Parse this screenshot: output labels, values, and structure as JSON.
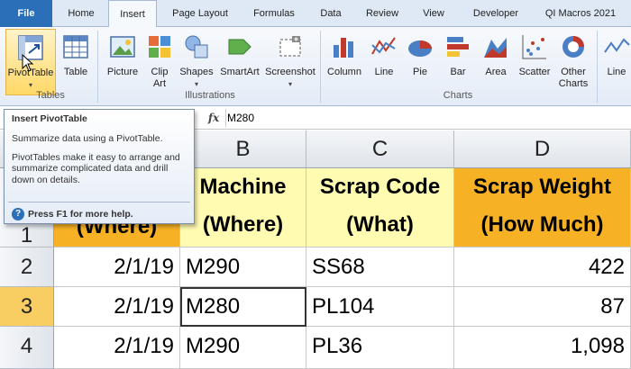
{
  "tabs": [
    "File",
    "Home",
    "Insert",
    "Page Layout",
    "Formulas",
    "Data",
    "Review",
    "View",
    "Developer",
    "QI Macros 2021"
  ],
  "ribbon": {
    "buttons": {
      "pivottable": "PivotTable",
      "table": "Table",
      "picture": "Picture",
      "clipart": "Clip Art",
      "shapes": "Shapes",
      "smartart": "SmartArt",
      "screenshot": "Screenshot",
      "column": "Column",
      "line": "Line",
      "pie": "Pie",
      "bar": "Bar",
      "area": "Area",
      "scatter": "Scatter",
      "othercharts": "Other Charts",
      "sparkline": "Line"
    },
    "groups": {
      "tables": "Tables",
      "illustrations": "Illustrations",
      "charts": "Charts"
    }
  },
  "formula_bar": {
    "fx": "fx",
    "value": "M280"
  },
  "tooltip": {
    "title": "Insert PivotTable",
    "line1": "Summarize data using a PivotTable.",
    "line2": "PivotTables make it easy to arrange and summarize complicated data and drill down on details.",
    "help": "Press F1 for more help."
  },
  "grid": {
    "columns": [
      "B",
      "C",
      "D"
    ],
    "row_headers": [
      "1",
      "2",
      "3",
      "4"
    ],
    "header_row": {
      "a": "(Where)",
      "b": "Machine (Where)",
      "c": "Scrap Code (What)",
      "d": "Scrap Weight (How Much)"
    },
    "rows": [
      {
        "a": "2/1/19",
        "b": "M290",
        "c": "SS68",
        "d": "422"
      },
      {
        "a": "2/1/19",
        "b": "M280",
        "c": "PL104",
        "d": "87"
      },
      {
        "a": "2/1/19",
        "b": "M290",
        "c": "PL36",
        "d": "1,098"
      }
    ]
  },
  "colors": {
    "file_tab": "#2a6fb8",
    "header_yellow": "#fffbb0",
    "header_orange": "#f7b124",
    "row_selected": "#f8cd62"
  }
}
